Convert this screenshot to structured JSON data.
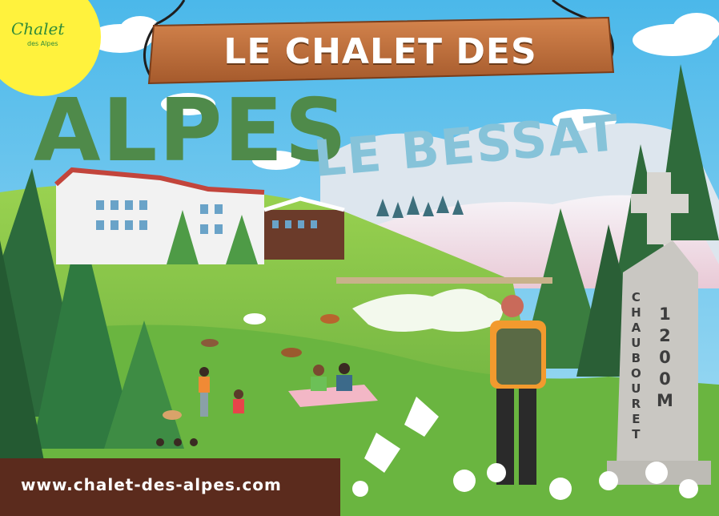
{
  "sign": {
    "title": "LE CHALET DES"
  },
  "headline": {
    "word1": "ALPES",
    "word2": "LE BESSAT"
  },
  "logo": {
    "name": "Chalet",
    "sub": "des Alpes"
  },
  "monument": {
    "name_letters": [
      "C",
      "H",
      "A",
      "U",
      "B",
      "O",
      "U",
      "R",
      "E",
      "T"
    ],
    "altitude_letters": [
      "1",
      "2",
      "0",
      "0",
      "M"
    ]
  },
  "footer": {
    "url": "www.chalet-des-alpes.com"
  },
  "colors": {
    "sky": "#5fc0ec",
    "grass": "#7cc243",
    "sign_wood": "#b8693a",
    "alpes_green": "#4f8a4a",
    "bessat_blue": "#86c3d9",
    "logo_yellow": "#fff23d",
    "footer_brown": "#5b2b1d"
  }
}
